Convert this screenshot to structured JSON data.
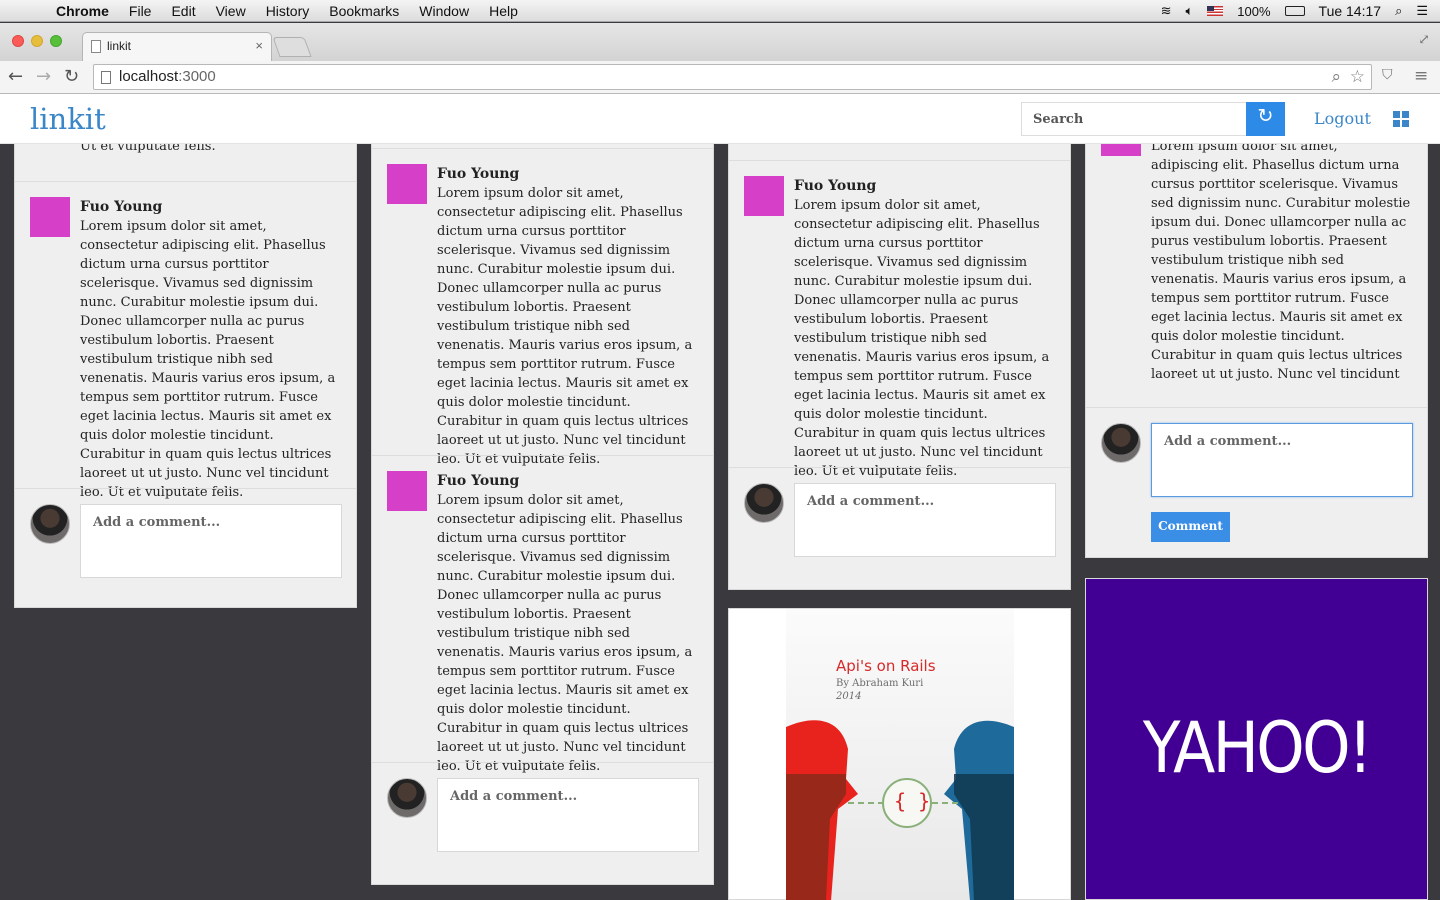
{
  "menubar": {
    "apple_icon": "",
    "items": [
      "Chrome",
      "File",
      "Edit",
      "View",
      "History",
      "Bookmarks",
      "Window",
      "Help"
    ],
    "battery": "100%",
    "clock": "Tue 14:17"
  },
  "browser": {
    "tab_title": "linkit",
    "tab_close": "×",
    "url_host": "localhost",
    "url_port": ":3000"
  },
  "site": {
    "logo": "linkit",
    "search_placeholder": "Search",
    "search_button_icon": "↻",
    "logout": "Logout"
  },
  "post_text": {
    "author": "Fuo Young",
    "body": "Lorem ipsum dolor sit amet, consectetur adipiscing elit. Phasellus dictum urna cursus porttitor scelerisque. Vivamus sed dignissim nunc. Curabitur molestie ipsum dui. Donec ullamcorper nulla ac purus vestibulum lobortis. Praesent vestibulum tristique nibh sed venenatis. Mauris varius eros ipsum, a tempus sem porttitor rutrum. Fusce eget lacinia lectus. Mauris sit amet ex quis dolor molestie tincidunt. Curabitur in quam quis lectus ultrices laoreet ut ut justo. Nunc vel tincidunt leo. Ut et vulputate felis.",
    "cut_top_col1": "Ut et vulputate felis.",
    "cut_top_col4": "Lorem ipsum dolor sit amet, consectetur"
  },
  "comments": {
    "placeholder": "Add a comment...",
    "button": "Comment"
  },
  "cards": {
    "book_title": "Api's on Rails",
    "book_author": "By Abraham Kuri",
    "book_year": "2014",
    "book_icon": "{ }",
    "yahoo_logo": "YAHOO!"
  },
  "colors": {
    "accent": "#2d8ae6",
    "avatar_square": "#d63fc8",
    "yahoo_purple": "#410093"
  }
}
